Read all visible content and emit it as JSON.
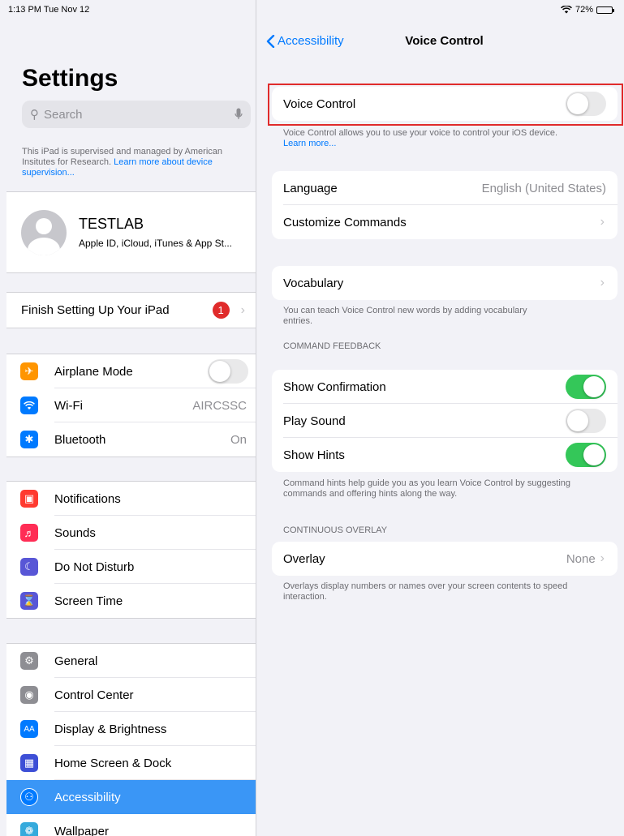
{
  "status": {
    "time": "1:13 PM  Tue Nov 12",
    "battery": "72%",
    "battery_level": 0.72
  },
  "left": {
    "title": "Settings",
    "search_placeholder": "Search",
    "supervised_text": "This iPad is supervised and managed by American Insitutes for Research.",
    "supervised_link": "Learn more about device supervision...",
    "account": {
      "name": "TESTLAB",
      "subtitle": "Apple ID, iCloud, iTunes & App St..."
    },
    "finish": {
      "label": "Finish Setting Up Your iPad",
      "badge": "1"
    },
    "network": [
      {
        "label": "Airplane Mode",
        "icon": "airplane-icon",
        "color": "#ff9500",
        "toggle": false
      },
      {
        "label": "Wi-Fi",
        "icon": "wifi-icon",
        "color": "#007aff",
        "value": "AIRCSSC"
      },
      {
        "label": "Bluetooth",
        "icon": "bluetooth-icon",
        "color": "#007aff",
        "value": "On"
      }
    ],
    "notif": [
      {
        "label": "Notifications",
        "icon": "notifications-icon",
        "color": "#ff3b30"
      },
      {
        "label": "Sounds",
        "icon": "speaker-icon",
        "color": "#ff2d55"
      },
      {
        "label": "Do Not Disturb",
        "icon": "moon-icon",
        "color": "#5856d6"
      },
      {
        "label": "Screen Time",
        "icon": "hourglass-icon",
        "color": "#5856d6"
      }
    ],
    "general": [
      {
        "label": "General",
        "icon": "gear-icon",
        "color": "#8e8e93"
      },
      {
        "label": "Control Center",
        "icon": "switches-icon",
        "color": "#8e8e93"
      },
      {
        "label": "Display & Brightness",
        "icon": "aa-icon",
        "color": "#007aff"
      },
      {
        "label": "Home Screen & Dock",
        "icon": "grid-icon",
        "color": "#3d4fd6"
      },
      {
        "label": "Accessibility",
        "icon": "accessibility-icon",
        "color": "#007aff",
        "selected": true
      },
      {
        "label": "Wallpaper",
        "icon": "flower-icon",
        "color": "#35aadc"
      }
    ]
  },
  "right": {
    "back_label": "Accessibility",
    "title": "Voice Control",
    "voice_control": {
      "label": "Voice Control",
      "on": false
    },
    "voice_control_footer": "Voice Control allows you to use your voice to control your iOS device.",
    "voice_control_link": "Learn more...",
    "language": {
      "label": "Language",
      "value": "English (United States)"
    },
    "customize": {
      "label": "Customize Commands"
    },
    "vocabulary": {
      "label": "Vocabulary"
    },
    "vocabulary_footer": "You can teach Voice Control new words by adding vocabulary entries.",
    "feedback_header": "COMMAND FEEDBACK",
    "feedback": [
      {
        "label": "Show Confirmation",
        "on": true
      },
      {
        "label": "Play Sound",
        "on": false
      },
      {
        "label": "Show Hints",
        "on": true
      }
    ],
    "feedback_footer": "Command hints help guide you as you learn Voice Control by suggesting commands and offering hints along the way.",
    "overlay_header": "CONTINUOUS OVERLAY",
    "overlay": {
      "label": "Overlay",
      "value": "None"
    },
    "overlay_footer": "Overlays display numbers or names over your screen contents to speed interaction."
  }
}
